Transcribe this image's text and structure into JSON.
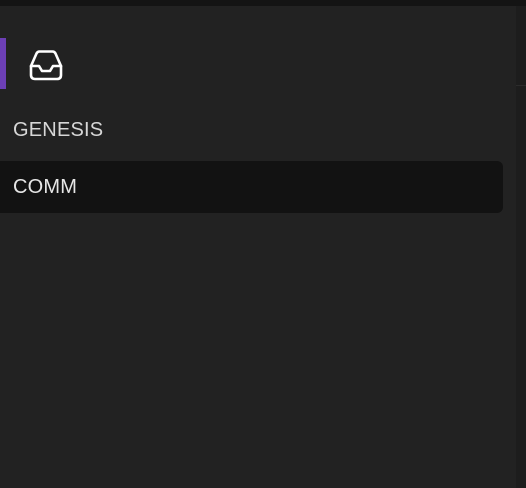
{
  "sidebar": {
    "header_icon": "inbox-icon",
    "accent_color": "#6c3fb5",
    "items": [
      {
        "label": "GENESIS",
        "selected": false
      },
      {
        "label": "COMM",
        "selected": true
      }
    ]
  }
}
